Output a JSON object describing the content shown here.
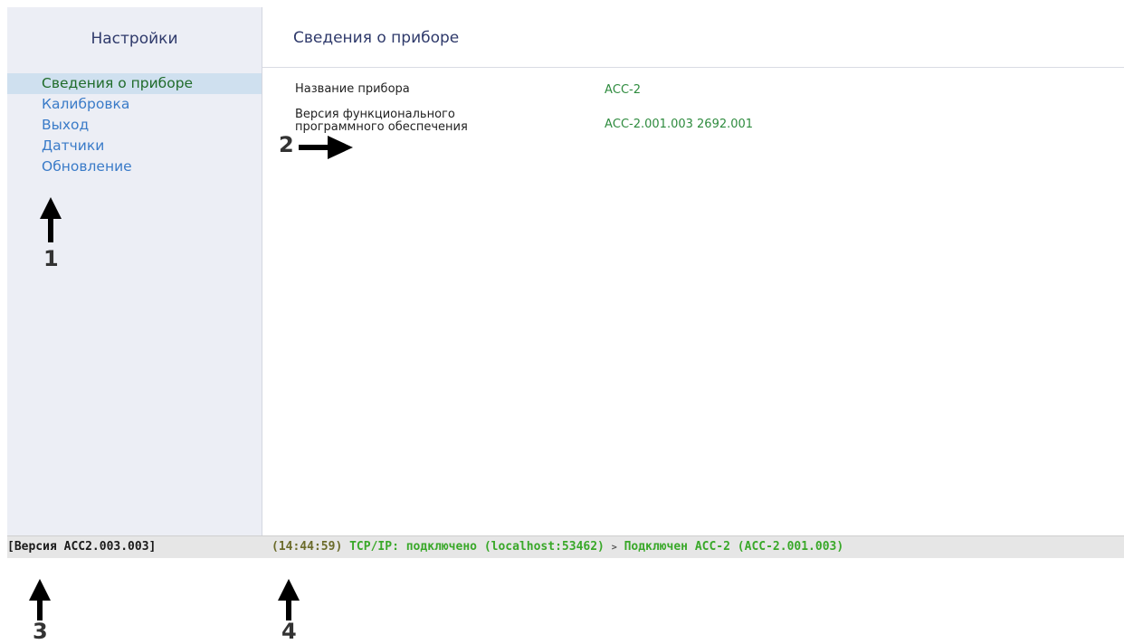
{
  "sidebar": {
    "title": "Настройки",
    "items": [
      {
        "label": "Сведения о приборе",
        "active": true
      },
      {
        "label": "Калибровка",
        "active": false
      },
      {
        "label": "Выход",
        "active": false
      },
      {
        "label": "Датчики",
        "active": false
      },
      {
        "label": "Обновление",
        "active": false
      }
    ]
  },
  "main": {
    "title": "Сведения о приборе",
    "rows": [
      {
        "label": "Название прибора",
        "value": "АСС-2"
      },
      {
        "label_line1": "Версия функционального",
        "label_line2": "программного обеспечения",
        "value": "АСС-2.001.003 2692.001"
      }
    ]
  },
  "statusbar": {
    "version": "[Версия АСС2.003.003]",
    "time": "(14:44:59)",
    "connection": "TCP/IP: подключено (localhost:53462)",
    "separator": ">",
    "device": "Подключен АСС-2 (АСС-2.001.003)"
  },
  "annotations": {
    "one": "1",
    "two": "2",
    "three": "3",
    "four": "4"
  },
  "colors": {
    "sidebar_bg": "#eceef5",
    "active_bg": "#cfe0ef",
    "link": "#3a7bc8",
    "value": "#2e8b3e",
    "status_green": "#39a829"
  }
}
